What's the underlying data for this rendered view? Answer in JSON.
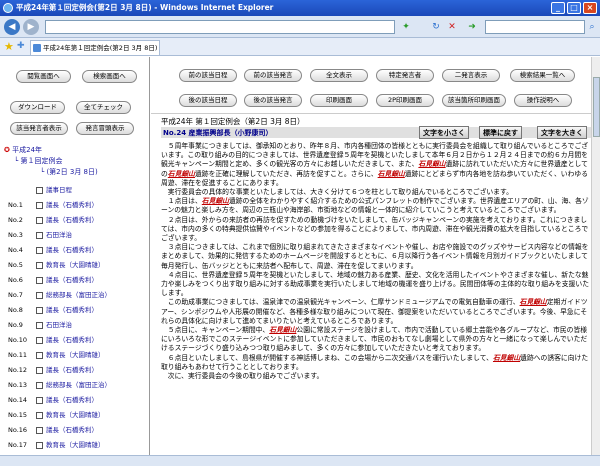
{
  "window": {
    "title": "平成24年第１回定例会(第2日 3月 8日) - Windows Internet Explorer"
  },
  "tab": {
    "label": "平成24年第１回定例会(第2日 3月 8日)"
  },
  "left_buttons": {
    "dai_kensaku": "閲覧画面へ",
    "kensaku_gamen": "検索画面へ",
    "download": "ダウンロード",
    "all_check": "全てチェック",
    "speaker_show": "該当発言者表示",
    "speech_table": "発言冒頭表示"
  },
  "tree": {
    "root": "平成24年",
    "session": "第１回定例会",
    "day": "(第2日 3月 8日)"
  },
  "members": [
    {
      "no": "",
      "name": "議事日程"
    },
    {
      "no": "No.1",
      "name": "議長（石橋秀利）"
    },
    {
      "no": "No.2",
      "name": "議長（石橋秀利）"
    },
    {
      "no": "No.3",
      "name": "石田洋治"
    },
    {
      "no": "No.4",
      "name": "議長（石橋秀利）"
    },
    {
      "no": "No.5",
      "name": "教育長（大園晴雄）"
    },
    {
      "no": "No.6",
      "name": "議長（石橋秀利）"
    },
    {
      "no": "No.7",
      "name": "総務部長（富田正治）"
    },
    {
      "no": "No.8",
      "name": "議長（石橋秀利）"
    },
    {
      "no": "No.9",
      "name": "石田洋治"
    },
    {
      "no": "No.10",
      "name": "議長（石橋秀利）"
    },
    {
      "no": "No.11",
      "name": "教育長（大園晴雄）"
    },
    {
      "no": "No.12",
      "name": "議長（石橋秀利）"
    },
    {
      "no": "No.13",
      "name": "総務部長（富田正治）"
    },
    {
      "no": "No.14",
      "name": "議長（石橋秀利）"
    },
    {
      "no": "No.15",
      "name": "教育長（大園晴雄）"
    },
    {
      "no": "No.16",
      "name": "議長（石橋秀利）"
    },
    {
      "no": "No.17",
      "name": "教育長（大園晴雄）"
    },
    {
      "no": "No.18",
      "name": "議長（石橋秀利）"
    }
  ],
  "nav_buttons": {
    "prev_item": "前の該当日程",
    "prev_speech": "前の該当発言",
    "full_view": "全文表示",
    "specific_speaker": "特定発言者",
    "two_screen": "二発言表示",
    "search_results": "検索結果一覧へ",
    "next_item": "後の該当日程",
    "next_speech": "後の該当発言",
    "print": "印刷画面",
    "print2p": "2P印刷画面",
    "hit_print": "該当箇所印刷画面",
    "manual": "操作説明へ"
  },
  "doc": {
    "session_header": "平成24年 第１回定例会（第2日 3月 8日）",
    "speaker": "No.24 産業振興部長（小野康司）",
    "font_small": "文字を小さく",
    "font_normal": "標準に戻す",
    "font_large": "文字を大きく"
  },
  "paragraphs": [
    [
      {
        "t": "５周年事業につきましては、御承知のとおり、昨年８月、市内各種団体の皆様とともに実行委員会を組織して取り組んでいるところでございます。この取り組みの目的につきましては、世界遺産登録５周年を契機といたしまして本年６月２日から１２月２４日までの約６カ月間を観光キャンペーン期間と定め、多くの観光客の方々にお越しいただきまして、また、"
      },
      {
        "t": "石見銀山",
        "h": true
      },
      {
        "t": "遺跡に訪れていただいた方々に世界遺産としての"
      },
      {
        "t": "石見銀山",
        "h": true
      },
      {
        "t": "遺跡を正確に理解していただき、再訪を促すこと。さらに、"
      },
      {
        "t": "石見銀山",
        "h": true
      },
      {
        "t": "遺跡にとどまらず市内各地を訪ね歩いていただく、いわゆる周遊、滞在を促進することにあります。"
      }
    ],
    [
      {
        "t": "実行委員会の具体的な事業といたしましては、大きく分けて６つを柱として取り組んでいるところでございます。"
      }
    ],
    [
      {
        "t": "１点目は、"
      },
      {
        "t": "石見銀山",
        "h": true
      },
      {
        "t": "遺跡の全体をわかりやすく紹介するための公式パンフレットの制作でございます。世界遺産エリアの町、山、海、各ゾーンの魅力と楽しみ方を、周辺の三瓶山や海岸部、市街地などの情報と一体的に紹介していこうと考えているところでございます。"
      }
    ],
    [
      {
        "t": "２点目は、外からの来訪者の再訪を促すための動機づけをいたしまして、缶バッジキャンペーンの実施を考えております。これにつきましては、市内の多くの特典提供協賛やイベントなどの参加を得ることによりまして、市内周遊、滞在や観光消費の拡大を目指しているところでございます。"
      }
    ],
    [
      {
        "t": "３点目につきましては、これまで個別に取り組まれてきたさまざまなイベントや催し、お店や施設でのグッズやサービス内容などの情報をまとめまして、効果的に発信するためのホームページを開設するとともに、６月以降行う各イベント情報を月別ガイドブックといたしまして毎月発行し、缶バッジとともに来訪者へ配布して、周遊、滞在を促してまいります。"
      }
    ],
    [
      {
        "t": "４点目に、世界遺産登録５周年を契機といたしまして、地域の魅力ある産業、歴史、文化を活用したイベントやさまざまな催し、新たな魅力や楽しみをつくり出す取り組みに対する助成事業を実行いたしまして地域の機運を盛り上げる。民間団体等の主体的な取り組みを支援いたします。"
      }
    ],
    [
      {
        "t": "この助成事業につきましては、温泉津での温泉観光キャンペーン、仁摩サンドミュージアムでの電気自動車の運行、"
      },
      {
        "t": "石見銀山",
        "h": true
      },
      {
        "t": "定期ガイドツアー、シンポジウムや人形展の開催など、各種多様な取り組みについて現在、御提案をいただいているところでございます。今後、早急にそれらの具体化に向けまして進めてまいりたいと考えているところであります。"
      }
    ],
    [
      {
        "t": "５点目に、キャンペーン期間中、"
      },
      {
        "t": "石見銀山",
        "h": true
      },
      {
        "t": "公園に常設ステージを設けまして、市内で活動している郷土芸能や各グループなど、市民の皆様にいろいろな形でこのステージイベントに参加していただきまして、市民のおもてなし劇場として県外の方々と一緒になって楽しんでいただけるステージづくり盛り込みつつ取り組みまして、多くの方々に参加していただきたいと考えております。"
      }
    ],
    [
      {
        "t": "６点目といたしまして、島根県が開催する神話博しまね、この会場から二次交通バスを運行いたしまして、"
      },
      {
        "t": "石見銀山",
        "h": true
      },
      {
        "t": "遺跡への誘客に向けた取り組みもあわせて行うこととしております。"
      }
    ],
    [
      {
        "t": "次に、実行委員会の今後の取り組みでございます。"
      }
    ]
  ],
  "search": {
    "value": ""
  }
}
